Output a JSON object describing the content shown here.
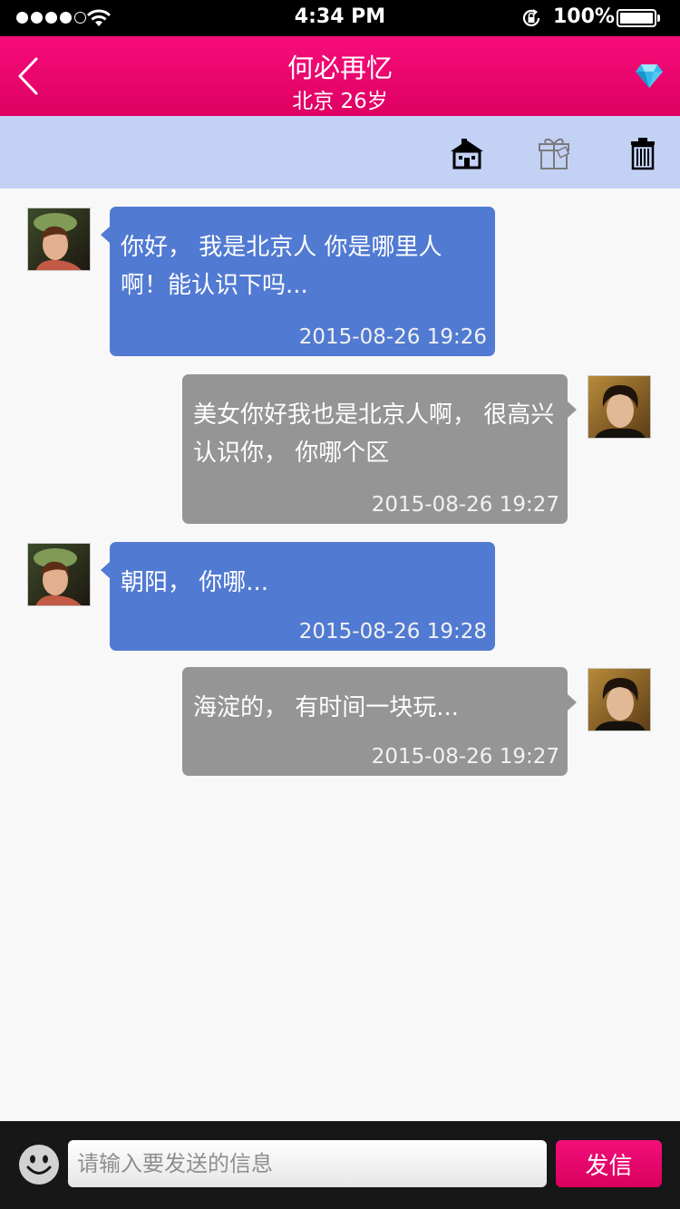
{
  "status_bar": {
    "time": "4:34 PM",
    "battery": "100%",
    "signal_bars_filled": 4,
    "signal_bars_total": 5
  },
  "nav": {
    "title": "何必再忆",
    "subtitle": "北京  26岁",
    "back_icon": "chevron-left-icon",
    "vip_icon": "diamond-icon"
  },
  "actions": {
    "home_icon": "house-icon",
    "gift_icon": "gift-icon",
    "delete_icon": "trash-icon"
  },
  "messages": [
    {
      "side": "in",
      "text": "你好， 我是北京人 你是哪里人啊！能认识下吗...",
      "time": "2015-08-26 19:26"
    },
    {
      "side": "out",
      "text": "美女你好我也是北京人啊， 很高兴认识你， 你哪个区",
      "time": "2015-08-26 19:27"
    },
    {
      "side": "in",
      "text": "朝阳， 你哪...",
      "time": "2015-08-26 19:28"
    },
    {
      "side": "out",
      "text": "海淀的， 有时间一块玩...",
      "time": "2015-08-26 19:27"
    }
  ],
  "input_bar": {
    "placeholder": "请输入要发送的信息",
    "value": "",
    "send_label": "发信",
    "emoji_icon": "smiley-icon"
  },
  "colors": {
    "accent": "#f00872",
    "incoming_bubble": "#517ad2",
    "outgoing_bubble": "#959595",
    "action_bar": "#c3d1f5"
  }
}
